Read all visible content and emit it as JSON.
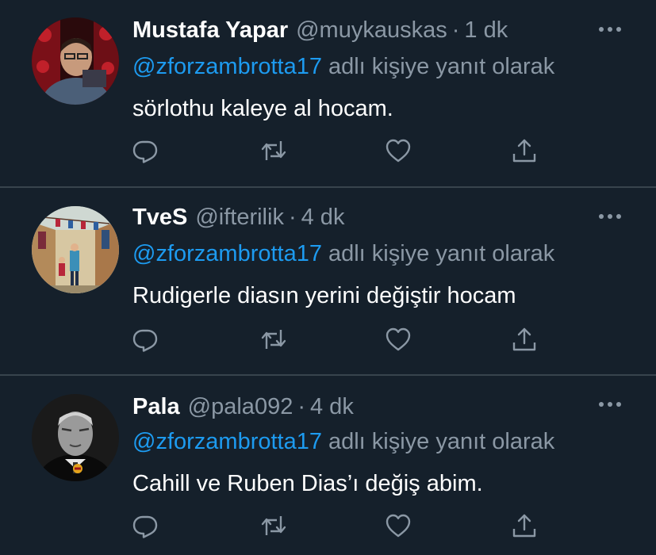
{
  "tweets": [
    {
      "display_name": "Mustafa Yapar",
      "handle": "@muykauskas",
      "separator": "·",
      "time": "1 dk",
      "reply_to": "@zforzambrotta17",
      "reply_suffix": "adlı kişiye yanıt olarak",
      "text": "sörlothu kaleye al hocam.",
      "avatar_icon": "avatar-mustafa"
    },
    {
      "display_name": "TveS",
      "handle": "@ifterilik",
      "separator": "·",
      "time": "4 dk",
      "reply_to": "@zforzambrotta17",
      "reply_suffix": "adlı kişiye yanıt olarak",
      "text": "Rudigerle diasın yerini değiştir hocam",
      "avatar_icon": "avatar-tves"
    },
    {
      "display_name": "Pala",
      "handle": "@pala092",
      "separator": "·",
      "time": "4 dk",
      "reply_to": "@zforzambrotta17",
      "reply_suffix": "adlı kişiye yanıt olarak",
      "text": "Cahill ve Ruben Dias’ı değiş abim.",
      "avatar_icon": "avatar-pala"
    }
  ],
  "actions": [
    "reply-icon",
    "retweet-icon",
    "like-icon",
    "share-icon"
  ],
  "colors": {
    "background": "#15202b",
    "divider": "#38444d",
    "secondary_text": "#8b98a5",
    "mention": "#1d9bf0",
    "primary_text": "#ffffff"
  }
}
